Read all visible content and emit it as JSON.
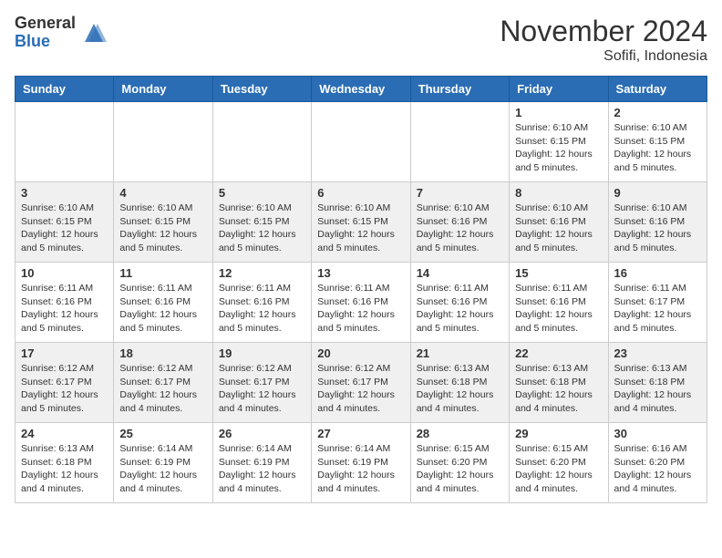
{
  "header": {
    "logo_general": "General",
    "logo_blue": "Blue",
    "month_title": "November 2024",
    "location": "Sofifi, Indonesia"
  },
  "columns": [
    "Sunday",
    "Monday",
    "Tuesday",
    "Wednesday",
    "Thursday",
    "Friday",
    "Saturday"
  ],
  "weeks": [
    [
      {
        "day": "",
        "info": ""
      },
      {
        "day": "",
        "info": ""
      },
      {
        "day": "",
        "info": ""
      },
      {
        "day": "",
        "info": ""
      },
      {
        "day": "",
        "info": ""
      },
      {
        "day": "1",
        "info": "Sunrise: 6:10 AM\nSunset: 6:15 PM\nDaylight: 12 hours and 5 minutes."
      },
      {
        "day": "2",
        "info": "Sunrise: 6:10 AM\nSunset: 6:15 PM\nDaylight: 12 hours and 5 minutes."
      }
    ],
    [
      {
        "day": "3",
        "info": "Sunrise: 6:10 AM\nSunset: 6:15 PM\nDaylight: 12 hours and 5 minutes."
      },
      {
        "day": "4",
        "info": "Sunrise: 6:10 AM\nSunset: 6:15 PM\nDaylight: 12 hours and 5 minutes."
      },
      {
        "day": "5",
        "info": "Sunrise: 6:10 AM\nSunset: 6:15 PM\nDaylight: 12 hours and 5 minutes."
      },
      {
        "day": "6",
        "info": "Sunrise: 6:10 AM\nSunset: 6:15 PM\nDaylight: 12 hours and 5 minutes."
      },
      {
        "day": "7",
        "info": "Sunrise: 6:10 AM\nSunset: 6:16 PM\nDaylight: 12 hours and 5 minutes."
      },
      {
        "day": "8",
        "info": "Sunrise: 6:10 AM\nSunset: 6:16 PM\nDaylight: 12 hours and 5 minutes."
      },
      {
        "day": "9",
        "info": "Sunrise: 6:10 AM\nSunset: 6:16 PM\nDaylight: 12 hours and 5 minutes."
      }
    ],
    [
      {
        "day": "10",
        "info": "Sunrise: 6:11 AM\nSunset: 6:16 PM\nDaylight: 12 hours and 5 minutes."
      },
      {
        "day": "11",
        "info": "Sunrise: 6:11 AM\nSunset: 6:16 PM\nDaylight: 12 hours and 5 minutes."
      },
      {
        "day": "12",
        "info": "Sunrise: 6:11 AM\nSunset: 6:16 PM\nDaylight: 12 hours and 5 minutes."
      },
      {
        "day": "13",
        "info": "Sunrise: 6:11 AM\nSunset: 6:16 PM\nDaylight: 12 hours and 5 minutes."
      },
      {
        "day": "14",
        "info": "Sunrise: 6:11 AM\nSunset: 6:16 PM\nDaylight: 12 hours and 5 minutes."
      },
      {
        "day": "15",
        "info": "Sunrise: 6:11 AM\nSunset: 6:16 PM\nDaylight: 12 hours and 5 minutes."
      },
      {
        "day": "16",
        "info": "Sunrise: 6:11 AM\nSunset: 6:17 PM\nDaylight: 12 hours and 5 minutes."
      }
    ],
    [
      {
        "day": "17",
        "info": "Sunrise: 6:12 AM\nSunset: 6:17 PM\nDaylight: 12 hours and 5 minutes."
      },
      {
        "day": "18",
        "info": "Sunrise: 6:12 AM\nSunset: 6:17 PM\nDaylight: 12 hours and 4 minutes."
      },
      {
        "day": "19",
        "info": "Sunrise: 6:12 AM\nSunset: 6:17 PM\nDaylight: 12 hours and 4 minutes."
      },
      {
        "day": "20",
        "info": "Sunrise: 6:12 AM\nSunset: 6:17 PM\nDaylight: 12 hours and 4 minutes."
      },
      {
        "day": "21",
        "info": "Sunrise: 6:13 AM\nSunset: 6:18 PM\nDaylight: 12 hours and 4 minutes."
      },
      {
        "day": "22",
        "info": "Sunrise: 6:13 AM\nSunset: 6:18 PM\nDaylight: 12 hours and 4 minutes."
      },
      {
        "day": "23",
        "info": "Sunrise: 6:13 AM\nSunset: 6:18 PM\nDaylight: 12 hours and 4 minutes."
      }
    ],
    [
      {
        "day": "24",
        "info": "Sunrise: 6:13 AM\nSunset: 6:18 PM\nDaylight: 12 hours and 4 minutes."
      },
      {
        "day": "25",
        "info": "Sunrise: 6:14 AM\nSunset: 6:19 PM\nDaylight: 12 hours and 4 minutes."
      },
      {
        "day": "26",
        "info": "Sunrise: 6:14 AM\nSunset: 6:19 PM\nDaylight: 12 hours and 4 minutes."
      },
      {
        "day": "27",
        "info": "Sunrise: 6:14 AM\nSunset: 6:19 PM\nDaylight: 12 hours and 4 minutes."
      },
      {
        "day": "28",
        "info": "Sunrise: 6:15 AM\nSunset: 6:20 PM\nDaylight: 12 hours and 4 minutes."
      },
      {
        "day": "29",
        "info": "Sunrise: 6:15 AM\nSunset: 6:20 PM\nDaylight: 12 hours and 4 minutes."
      },
      {
        "day": "30",
        "info": "Sunrise: 6:16 AM\nSunset: 6:20 PM\nDaylight: 12 hours and 4 minutes."
      }
    ]
  ]
}
